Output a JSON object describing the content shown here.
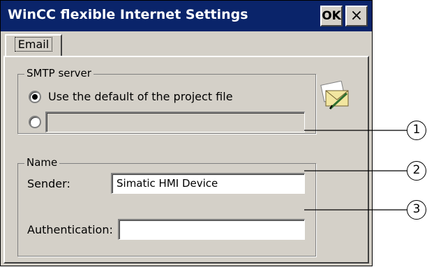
{
  "window": {
    "title": "WinCC flexible Internet Settings",
    "ok_label": "OK",
    "close_label": "×"
  },
  "tabs": [
    {
      "label": "Email",
      "active": true
    }
  ],
  "smtp": {
    "group_label": "SMTP server",
    "option_default_label": "Use the default of the project file",
    "option_default_selected": true,
    "option_custom_selected": false,
    "custom_value": ""
  },
  "name": {
    "group_label": "Name",
    "sender_label": "Sender:",
    "sender_value": "Simatic HMI Device",
    "auth_label": "Authentication:",
    "auth_value": ""
  },
  "icons": {
    "email_settings": "envelope-pencil-icon"
  },
  "callouts": [
    "1",
    "2",
    "3"
  ]
}
